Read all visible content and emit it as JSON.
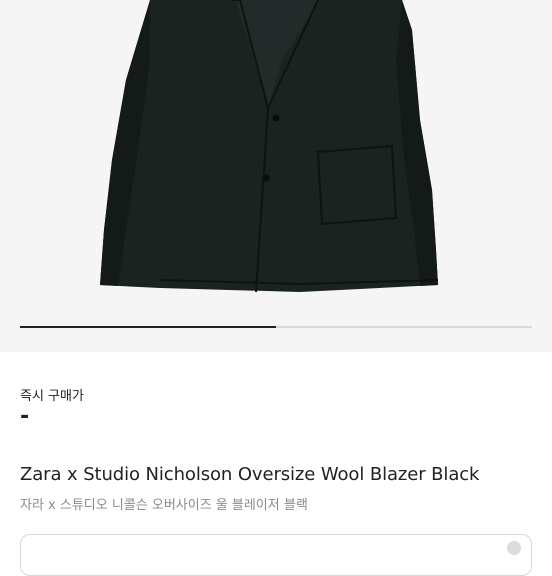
{
  "product": {
    "image_icon": "blazer-photo",
    "carousel_progress": 0.5,
    "title_en": "Zara x Studio Nicholson Oversize Wool Blazer Black",
    "title_ko": "자라 x 스튜디오 니콜슨 오버사이즈 울 블레이저 블랙"
  },
  "price": {
    "label": "즉시 구매가",
    "value": "-"
  },
  "colors": {
    "background": "#ffffff",
    "image_bg": "#f5f5f5",
    "blazer": "#1b2321",
    "text": "#222222",
    "subtext": "#8a8a8a"
  }
}
